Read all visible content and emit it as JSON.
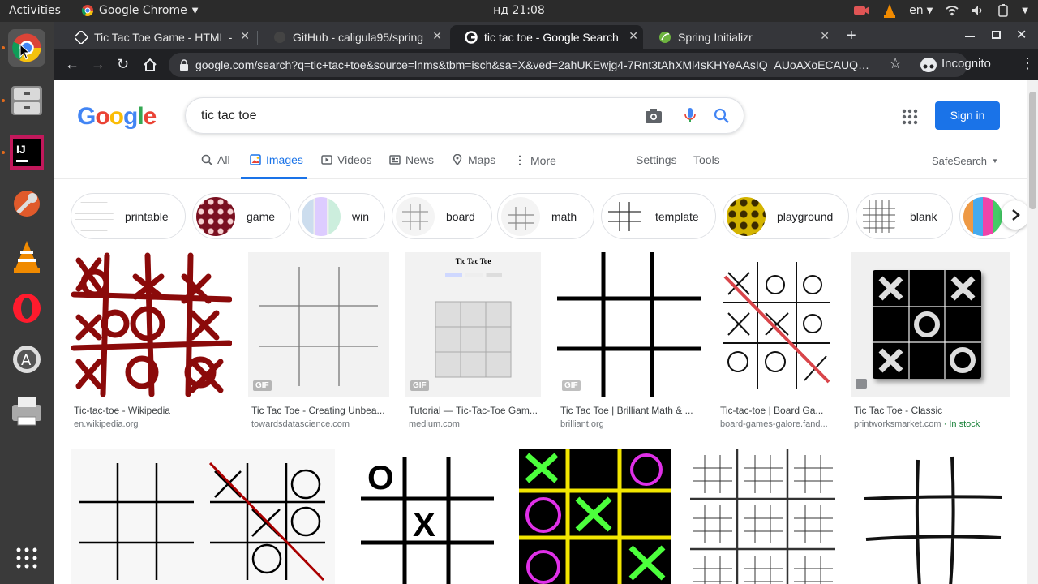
{
  "topbar": {
    "activities": "Activities",
    "app_name": "Google Chrome",
    "clock": "нд 21:08",
    "lang": "en"
  },
  "tabs": [
    {
      "title": "Tic Tac Toe Game - HTML -"
    },
    {
      "title": "GitHub - caligula95/spring"
    },
    {
      "title": "tic tac toe - Google Search"
    },
    {
      "title": "Spring Initializr"
    }
  ],
  "omnibox": {
    "url": "google.com/search?q=tic+tac+toe&source=lnms&tbm=isch&sa=X&ved=2ahUKEwjg4-7Rnt3tAhXMl4sKHYeAAsIQ_AUoAXoECAUQ…",
    "profile": "Incognito"
  },
  "google": {
    "query": "tic tac toe",
    "sign_in": "Sign in"
  },
  "search_tabs": [
    {
      "label": "All",
      "icon": "search-icon"
    },
    {
      "label": "Images",
      "icon": "image-icon"
    },
    {
      "label": "Videos",
      "icon": "video-icon"
    },
    {
      "label": "News",
      "icon": "news-icon"
    },
    {
      "label": "Maps",
      "icon": "map-pin-icon"
    },
    {
      "label": "More",
      "icon": "more-vert-icon"
    }
  ],
  "tools": {
    "settings": "Settings",
    "tools": "Tools",
    "safesearch": "SafeSearch"
  },
  "chips": [
    "printable",
    "game",
    "win",
    "board",
    "math",
    "template",
    "playground",
    "blank"
  ],
  "results_row1": [
    {
      "title": "Tic-tac-toe - Wikipedia",
      "site": "en.wikipedia.org",
      "stock": ""
    },
    {
      "title": "Tic Tac Toe - Creating Unbea...",
      "site": "towardsdatascience.com",
      "stock": ""
    },
    {
      "title": "Tutorial — Tic-Tac-Toe Gam...",
      "site": "medium.com",
      "stock": ""
    },
    {
      "title": "Tic Tac Toe | Brilliant Math & ...",
      "site": "brilliant.org",
      "stock": ""
    },
    {
      "title": "Tic-tac-toe | Board Ga...",
      "site": "board-games-galore.fand...",
      "stock": ""
    },
    {
      "title": "Tic Tac Toe - Classic",
      "site": "printworksmarket.com",
      "stock": " · In stock"
    }
  ],
  "labels": {
    "gif": "GIF",
    "thumb_heading": "Tic Tac Toe"
  },
  "colors": {
    "accent": "#1a73e8",
    "chrome_dark": "#202124"
  }
}
